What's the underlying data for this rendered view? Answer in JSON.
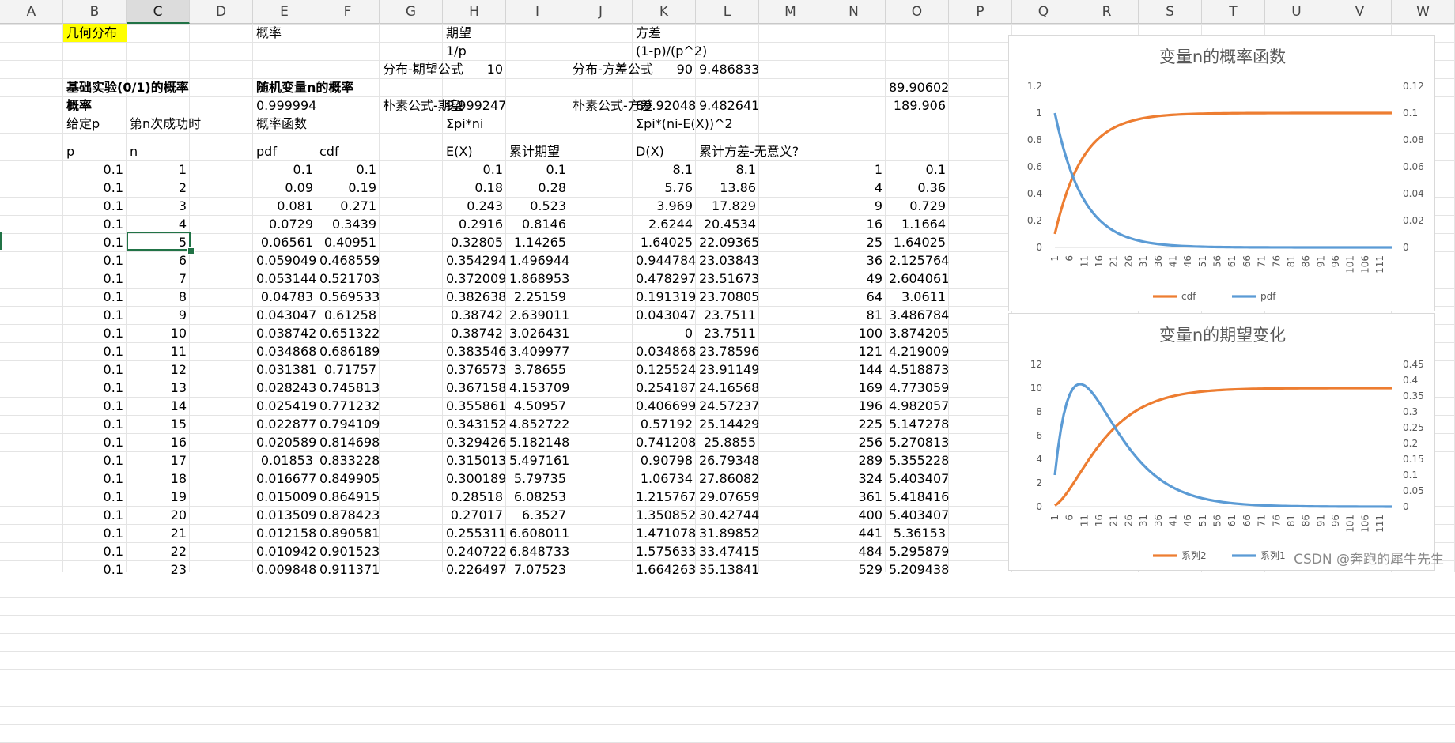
{
  "columns": [
    "A",
    "B",
    "C",
    "D",
    "E",
    "F",
    "G",
    "H",
    "I",
    "J",
    "K",
    "L",
    "M",
    "N",
    "O",
    "P",
    "Q",
    "R",
    "S",
    "T",
    "U",
    "V",
    "W"
  ],
  "selected_column": "C",
  "header_cells": {
    "B1": "几何分布",
    "E1": "概率",
    "H1": "期望",
    "K1": "方差",
    "H2": "1/p",
    "K2": "(1-p)/(p^2)",
    "G3": "分布-期望公式",
    "H3": "10",
    "J3": "分布-方差公式",
    "K3": "90",
    "L3": "9.486833",
    "B4": "基础实验(0/1)的概率",
    "E4": "随机变量n的概率",
    "O4": "89.90602",
    "B5": "概率",
    "E5": "0.999994",
    "G5": "朴素公式-期望",
    "H5": "9.999247",
    "J5": "朴素公式-方差",
    "K5": "89.92048",
    "L5": "9.482641",
    "O5": "189.906",
    "B6": "给定p",
    "C6": "第n次成功时",
    "E6": "概率函数",
    "H6": "Σpi*ni",
    "K6": "Σpi*(ni-E(X))^2",
    "B7": "p",
    "C7": "n",
    "E7": "pdf",
    "F7": "cdf",
    "H7": "E(X)",
    "I7": "累计期望",
    "K7": "D(X)",
    "L7": "累计方差-无意义?"
  },
  "table_rows": [
    [
      "0.1",
      "1",
      "0.1",
      "0.1",
      "0.1",
      "0.1",
      "8.1",
      "8.1",
      "1",
      "0.1"
    ],
    [
      "0.1",
      "2",
      "0.09",
      "0.19",
      "0.18",
      "0.28",
      "5.76",
      "13.86",
      "4",
      "0.36"
    ],
    [
      "0.1",
      "3",
      "0.081",
      "0.271",
      "0.243",
      "0.523",
      "3.969",
      "17.829",
      "9",
      "0.729"
    ],
    [
      "0.1",
      "4",
      "0.0729",
      "0.3439",
      "0.2916",
      "0.8146",
      "2.6244",
      "20.4534",
      "16",
      "1.1664"
    ],
    [
      "0.1",
      "5",
      "0.06561",
      "0.40951",
      "0.32805",
      "1.14265",
      "1.64025",
      "22.09365",
      "25",
      "1.64025"
    ],
    [
      "0.1",
      "6",
      "0.059049",
      "0.468559",
      "0.354294",
      "1.496944",
      "0.944784",
      "23.03843",
      "36",
      "2.125764"
    ],
    [
      "0.1",
      "7",
      "0.053144",
      "0.521703",
      "0.372009",
      "1.868953",
      "0.478297",
      "23.51673",
      "49",
      "2.604061"
    ],
    [
      "0.1",
      "8",
      "0.04783",
      "0.569533",
      "0.382638",
      "2.25159",
      "0.191319",
      "23.70805",
      "64",
      "3.0611"
    ],
    [
      "0.1",
      "9",
      "0.043047",
      "0.61258",
      "0.38742",
      "2.639011",
      "0.043047",
      "23.7511",
      "81",
      "3.486784"
    ],
    [
      "0.1",
      "10",
      "0.038742",
      "0.651322",
      "0.38742",
      "3.026431",
      "0",
      "23.7511",
      "100",
      "3.874205"
    ],
    [
      "0.1",
      "11",
      "0.034868",
      "0.686189",
      "0.383546",
      "3.409977",
      "0.034868",
      "23.78596",
      "121",
      "4.219009"
    ],
    [
      "0.1",
      "12",
      "0.031381",
      "0.71757",
      "0.376573",
      "3.78655",
      "0.125524",
      "23.91149",
      "144",
      "4.518873"
    ],
    [
      "0.1",
      "13",
      "0.028243",
      "0.745813",
      "0.367158",
      "4.153709",
      "0.254187",
      "24.16568",
      "169",
      "4.773059"
    ],
    [
      "0.1",
      "14",
      "0.025419",
      "0.771232",
      "0.355861",
      "4.50957",
      "0.406699",
      "24.57237",
      "196",
      "4.982057"
    ],
    [
      "0.1",
      "15",
      "0.022877",
      "0.794109",
      "0.343152",
      "4.852722",
      "0.57192",
      "25.14429",
      "225",
      "5.147278"
    ],
    [
      "0.1",
      "16",
      "0.020589",
      "0.814698",
      "0.329426",
      "5.182148",
      "0.741208",
      "25.8855",
      "256",
      "5.270813"
    ],
    [
      "0.1",
      "17",
      "0.01853",
      "0.833228",
      "0.315013",
      "5.497161",
      "0.90798",
      "26.79348",
      "289",
      "5.355228"
    ],
    [
      "0.1",
      "18",
      "0.016677",
      "0.849905",
      "0.300189",
      "5.79735",
      "1.06734",
      "27.86082",
      "324",
      "5.403407"
    ],
    [
      "0.1",
      "19",
      "0.015009",
      "0.864915",
      "0.28518",
      "6.08253",
      "1.215767",
      "29.07659",
      "361",
      "5.418416"
    ],
    [
      "0.1",
      "20",
      "0.013509",
      "0.878423",
      "0.27017",
      "6.3527",
      "1.350852",
      "30.42744",
      "400",
      "5.403407"
    ],
    [
      "0.1",
      "21",
      "0.012158",
      "0.890581",
      "0.255311",
      "6.608011",
      "1.471078",
      "31.89852",
      "441",
      "5.36153"
    ],
    [
      "0.1",
      "22",
      "0.010942",
      "0.901523",
      "0.240722",
      "6.848733",
      "1.575633",
      "33.47415",
      "484",
      "5.295879"
    ],
    [
      "0.1",
      "23",
      "0.009848",
      "0.911371",
      "0.226497",
      "7.07523",
      "1.664263",
      "35.13841",
      "529",
      "5.209438"
    ]
  ],
  "chart_data": [
    {
      "type": "line",
      "title": "变量n的概率函数",
      "x_ticks": [
        "1",
        "6",
        "11",
        "16",
        "21",
        "26",
        "31",
        "36",
        "41",
        "46",
        "51",
        "56",
        "61",
        "66",
        "71",
        "76",
        "81",
        "86",
        "91",
        "96",
        "101",
        "106",
        "111"
      ],
      "y_left_ticks": [
        "0",
        "0.2",
        "0.4",
        "0.6",
        "0.8",
        "1",
        "1.2"
      ],
      "y_left_lim": [
        0,
        1.2
      ],
      "y_right_ticks": [
        "0",
        "0.02",
        "0.04",
        "0.06",
        "0.08",
        "0.1",
        "0.12"
      ],
      "y_right_lim": [
        0,
        0.12
      ],
      "x_lim": [
        1,
        115
      ],
      "grid": false,
      "legend_position": "bottom",
      "series": [
        {
          "name": "cdf",
          "axis": "left",
          "color": "#ed7d31",
          "formula": "cdf",
          "p": 0.1
        },
        {
          "name": "pdf",
          "axis": "right",
          "color": "#5b9bd5",
          "formula": "pdf",
          "p": 0.1
        }
      ]
    },
    {
      "type": "line",
      "title": "变量n的期望变化",
      "x_ticks": [
        "1",
        "6",
        "11",
        "16",
        "21",
        "26",
        "31",
        "36",
        "41",
        "46",
        "51",
        "56",
        "61",
        "66",
        "71",
        "76",
        "81",
        "86",
        "91",
        "96",
        "101",
        "106",
        "111"
      ],
      "y_left_ticks": [
        "0",
        "2",
        "4",
        "6",
        "8",
        "10",
        "12"
      ],
      "y_left_lim": [
        0,
        12
      ],
      "y_right_ticks": [
        "0",
        "0.05",
        "0.1",
        "0.15",
        "0.2",
        "0.25",
        "0.3",
        "0.35",
        "0.4",
        "0.45"
      ],
      "y_right_lim": [
        0,
        0.45
      ],
      "x_lim": [
        1,
        115
      ],
      "grid": false,
      "legend_position": "bottom",
      "series": [
        {
          "name": "系列2",
          "axis": "left",
          "color": "#ed7d31",
          "formula": "cumulative_expectation",
          "p": 0.1
        },
        {
          "name": "系列1",
          "axis": "right",
          "color": "#5b9bd5",
          "formula": "expectation_term",
          "p": 0.1
        }
      ]
    }
  ],
  "watermark": "CSDN @奔跑的犀牛先生"
}
